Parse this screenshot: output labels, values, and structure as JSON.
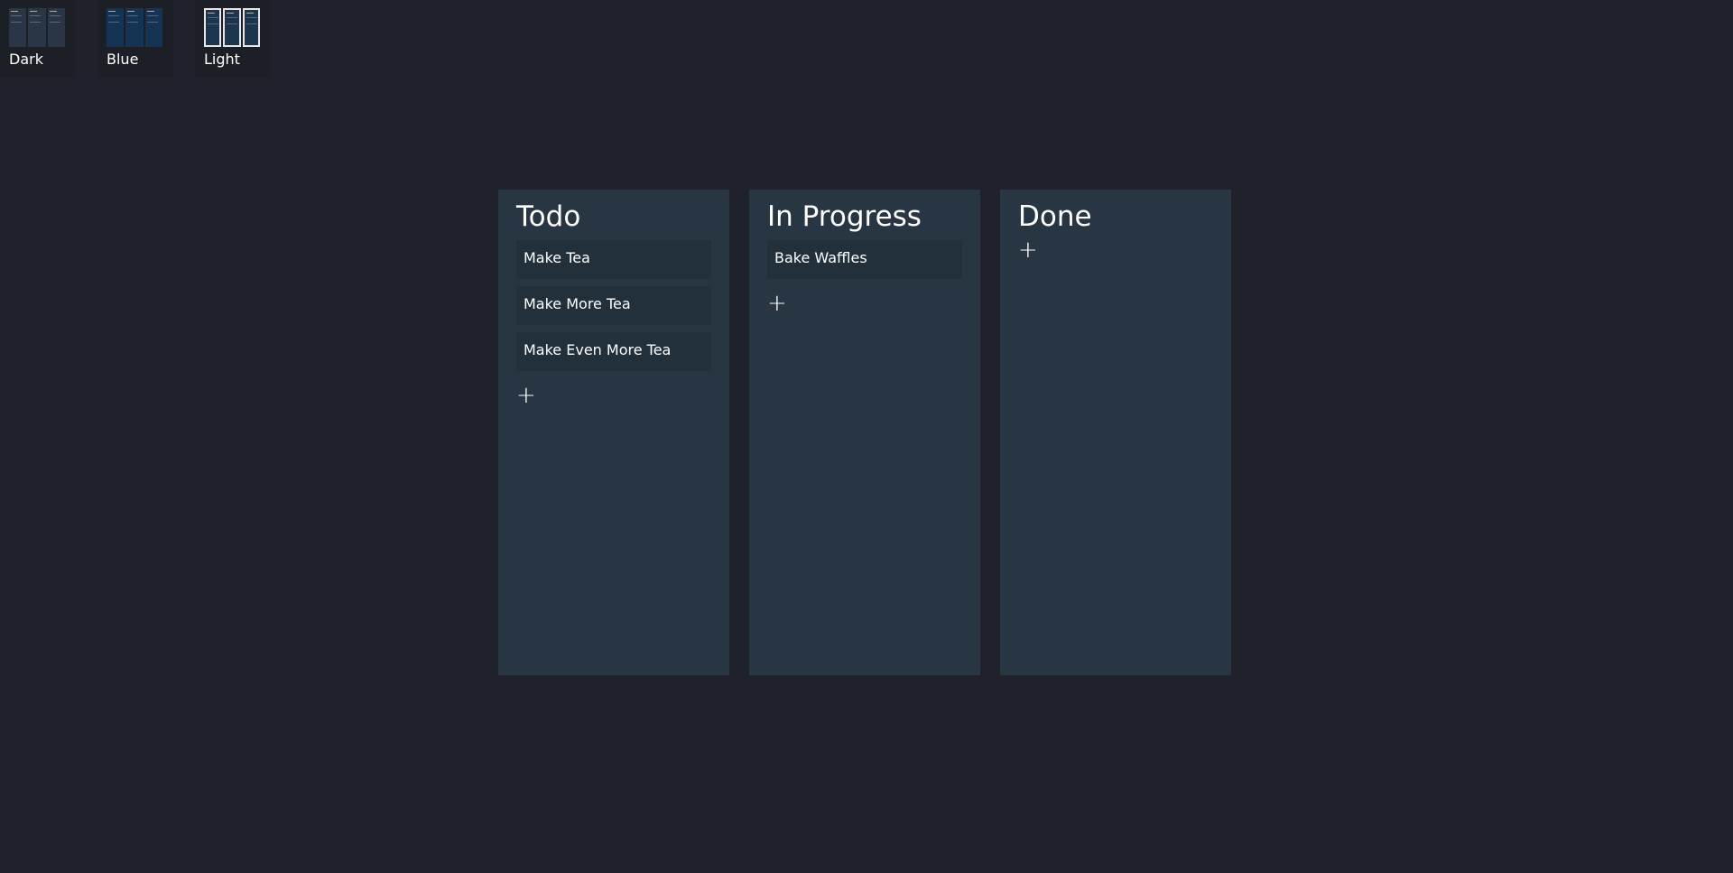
{
  "themes": [
    {
      "label": "Dark",
      "thumb": "dark"
    },
    {
      "label": "Blue",
      "thumb": "blue"
    },
    {
      "label": "Light",
      "thumb": "light"
    }
  ],
  "columns": [
    {
      "title": "Todo",
      "accent": "#8a4545",
      "cards": [
        "Make Tea",
        "Make More Tea",
        "Make Even More Tea"
      ],
      "add_label": "+"
    },
    {
      "title": "In Progress",
      "accent": "#8c7147",
      "cards": [
        "Bake Waffles"
      ],
      "add_label": "+"
    },
    {
      "title": "Done",
      "accent": "#4f7f3b",
      "cards": [],
      "add_label": "+"
    }
  ],
  "colors": {
    "page_background": "#1f222b",
    "column_background": "#283543",
    "card_background": "#22303c"
  }
}
